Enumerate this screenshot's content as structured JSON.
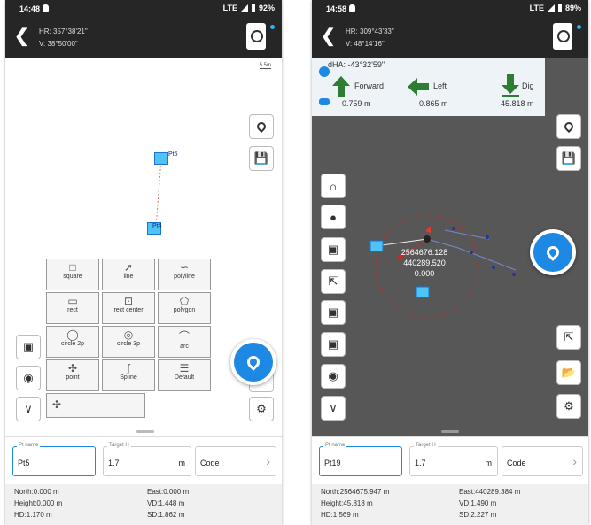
{
  "left": {
    "status": {
      "time": "14:48",
      "signal": "LTE",
      "battery": "92%"
    },
    "header": {
      "hr": "HR: 357°38'21\"",
      "v": "V: 38°50'00\""
    },
    "scale": "5.5m",
    "points": [
      {
        "label": "Pt5"
      },
      {
        "label": "Pt4"
      }
    ],
    "draw_tools": [
      {
        "label": "square",
        "icon": "square-icon"
      },
      {
        "label": "line",
        "icon": "line-icon"
      },
      {
        "label": "polyline",
        "icon": "polyline-icon"
      },
      {
        "label": "rect",
        "icon": "rect-icon"
      },
      {
        "label": "rect center",
        "icon": "rect-center-icon"
      },
      {
        "label": "polygon",
        "icon": "polygon-icon"
      },
      {
        "label": "circle 2p",
        "icon": "circle-2p-icon"
      },
      {
        "label": "circle 3p",
        "icon": "circle-3p-icon"
      },
      {
        "label": "arc",
        "icon": "arc-icon"
      },
      {
        "label": "point",
        "icon": "point-icon"
      },
      {
        "label": "Spline",
        "icon": "spline-icon"
      },
      {
        "label": "Default",
        "icon": "layers-icon"
      }
    ],
    "inputs": {
      "pt_label": "Pt name",
      "pt_value": "Pt5",
      "target_label": "Target H",
      "target_value": "1.7",
      "unit": "m",
      "code": "Code"
    },
    "info": {
      "north": "North:0.000 m",
      "east": "East:0.000 m",
      "height": "Height:0.000 m",
      "vd": "VD:1.448 m",
      "hd": "HD:1.170 m",
      "sd": "SD:1.862 m"
    }
  },
  "right": {
    "status": {
      "time": "14:58",
      "signal": "LTE",
      "battery": "89%"
    },
    "header": {
      "hr": "HR: 309°43'33\"",
      "v": "V: 48°14'16\""
    },
    "nav": {
      "dha": "dHA: -43°32'59\"",
      "forward_label": "Forward",
      "forward_value": "0.759 m",
      "left_label": "Left",
      "left_value": "0.865 m",
      "dig_label": "Dig",
      "dig_value": "45.818 m"
    },
    "coords": {
      "north": "2564676.128",
      "east": "440289.520",
      "height": "0.000"
    },
    "inputs": {
      "pt_label": "Pt name",
      "pt_value": "Pt19",
      "target_label": "Target H",
      "target_value": "1.7",
      "unit": "m",
      "code": "Code"
    },
    "info": {
      "north": "North:2564675.947 m",
      "east": "East:440289.384 m",
      "height": "Height:45.818 m",
      "vd": "VD:1.490 m",
      "hd": "HD:1.569 m",
      "sd": "SD:2.227 m"
    }
  },
  "colors": {
    "accent": "#1e88e5",
    "arrow": "#2e7d32",
    "header": "#262626"
  }
}
